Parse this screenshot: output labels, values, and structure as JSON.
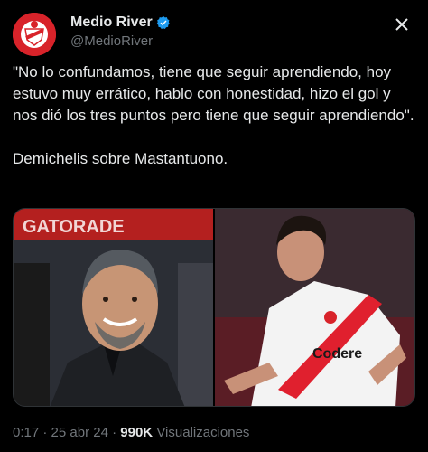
{
  "author": {
    "display_name": "Medio River",
    "handle": "@MedioRiver",
    "verified": true
  },
  "tweet": {
    "text": "\"No lo confundamos, tiene que seguir aprendiendo, hoy estuvo muy errático, hablo con honestidad, hizo el gol y nos dió los tres puntos pero tiene que seguir aprendiendo\".\n\nDemichelis sobre Mastantuono."
  },
  "media": {
    "left_banner_text": "GATORADE",
    "right_sponsor_text": "Codere"
  },
  "footer": {
    "time": "0:17",
    "date": "25 abr 24",
    "views_count": "990K",
    "views_label": "Visualizaciones"
  },
  "colors": {
    "background": "#000000",
    "text_primary": "#e7e9ea",
    "text_secondary": "#71767b",
    "verified_blue": "#1d9bf0",
    "avatar_red": "#d8232a"
  },
  "icons": {
    "verified": "verified-badge-icon",
    "close": "close-icon"
  }
}
